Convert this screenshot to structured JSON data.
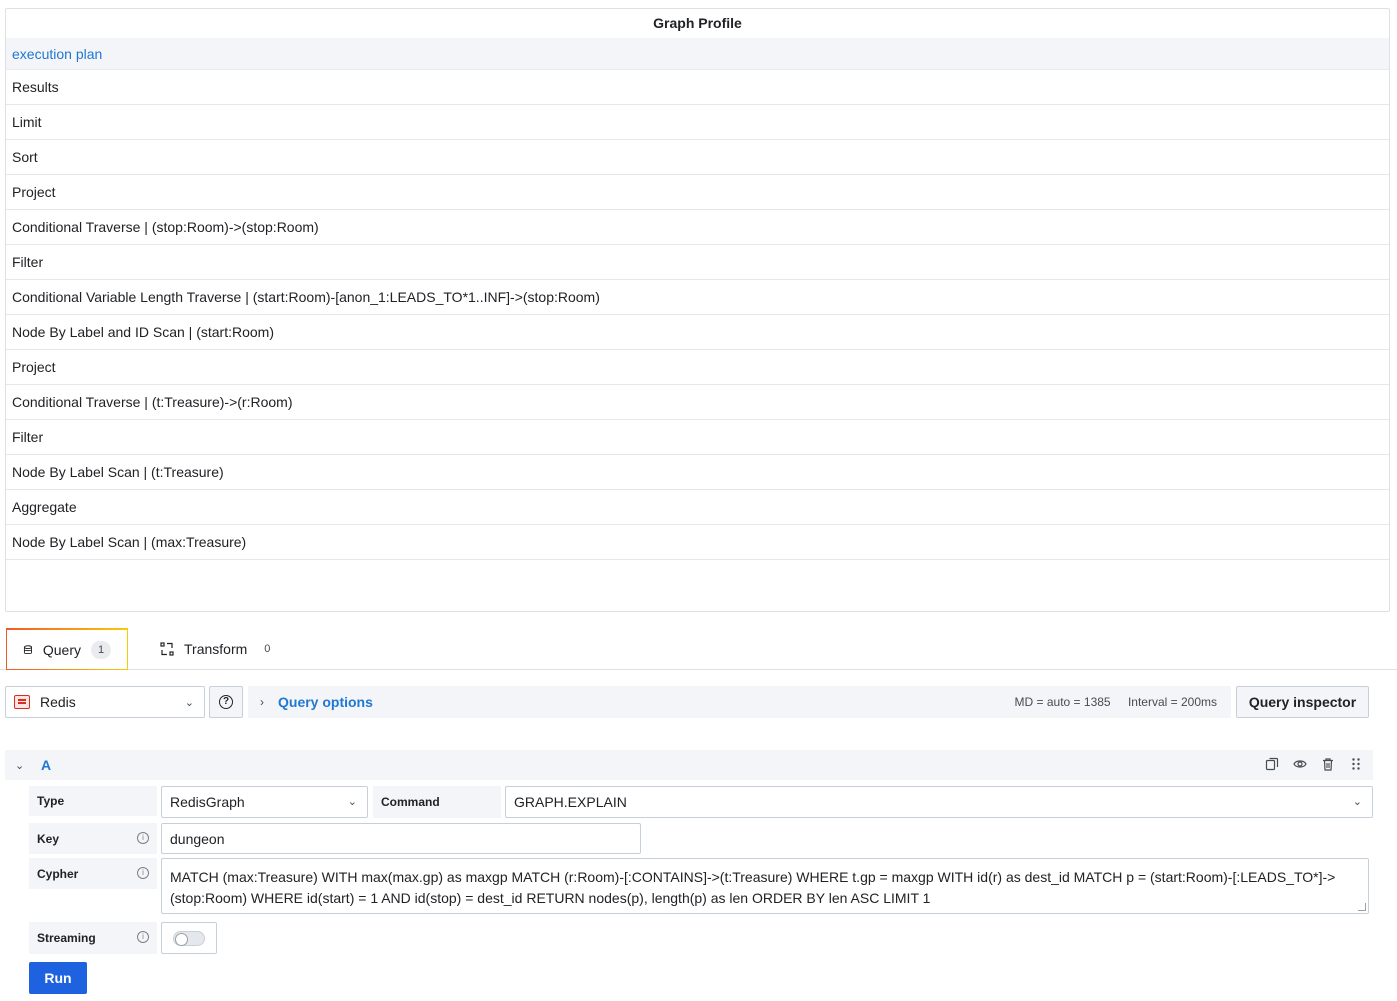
{
  "profile": {
    "title": "Graph Profile",
    "header": "execution plan",
    "rows": [
      "Results",
      "Limit",
      "Sort",
      "Project",
      "Conditional Traverse | (stop:Room)->(stop:Room)",
      "Filter",
      "Conditional Variable Length Traverse | (start:Room)-[anon_1:LEADS_TO*1..INF]->(stop:Room)",
      "Node By Label and ID Scan | (start:Room)",
      "Project",
      "Conditional Traverse | (t:Treasure)->(r:Room)",
      "Filter",
      "Node By Label Scan | (t:Treasure)",
      "Aggregate",
      "Node By Label Scan | (max:Treasure)"
    ]
  },
  "tabs": [
    {
      "label": "Query",
      "count": "1",
      "icon": "database-icon",
      "active": true
    },
    {
      "label": "Transform",
      "count": "0",
      "icon": "transform-icon",
      "active": false
    }
  ],
  "query_bar": {
    "datasource": "Redis",
    "datasource_icon": "redis-logo-icon",
    "query_options_label": "Query options",
    "md_info": "MD = auto = 1385",
    "interval_info": "Interval = 200ms",
    "inspector_label": "Query inspector"
  },
  "query_a": {
    "name": "A",
    "type_label": "Type",
    "type_value": "RedisGraph",
    "command_label": "Command",
    "command_value": "GRAPH.EXPLAIN",
    "key_label": "Key",
    "key_value": "dungeon",
    "cypher_label": "Cypher",
    "cypher_value": "MATCH (max:Treasure) WITH max(max.gp) as maxgp MATCH (r:Room)-[:CONTAINS]->(t:Treasure) WHERE t.gp = maxgp WITH id(r) as dest_id MATCH p = (start:Room)-[:LEADS_TO*]->(stop:Room) WHERE id(start) = 1 AND id(stop) = dest_id RETURN nodes(p), length(p) as len ORDER BY len ASC LIMIT 1",
    "streaming_label": "Streaming",
    "streaming_on": false,
    "run_label": "Run"
  },
  "colors": {
    "accent_blue": "#1f78d1",
    "run_button": "#1f62e0",
    "panel_bg": "#f4f5f8"
  }
}
